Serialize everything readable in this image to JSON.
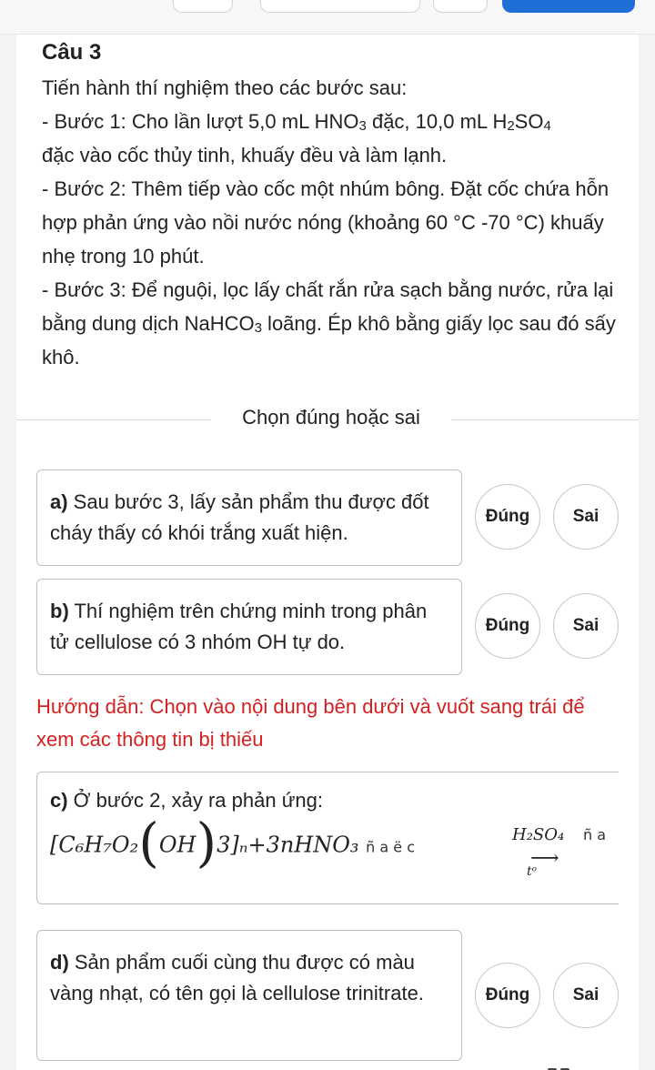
{
  "question": {
    "title": "Câu 3",
    "intro": "Tiến hành thí nghiệm theo các bước sau:",
    "step1_a": "- Bước 1: Cho lần lượt 5,0 mL HNO",
    "step1_sub1": "3",
    "step1_b": " đặc, 10,0 mL H",
    "step1_sub2": "2",
    "step1_c": "SO",
    "step1_sub3": "4",
    "step1_d": "đặc vào cốc thủy tinh, khuấy đều và làm lạnh.",
    "step2": "- Bước 2: Thêm tiếp vào cốc một nhúm bông. Đặt cốc chứa hỗn hợp phản ứng vào nồi nước nóng (khoảng 60 °C -70 °C) khuấy nhẹ trong 10 phút.",
    "step3_a": "- Bước 3: Để nguội, lọc lấy chất rắn rửa sạch bằng nước, rửa lại bằng dung dịch NaHCO",
    "step3_sub": "3",
    "step3_b": " loãng. Ép khô bằng giấy lọc sau đó sấy khô."
  },
  "section_title": "Chọn đúng hoặc sai",
  "statements": [
    {
      "label": "a)",
      "text": " Sau bước 3, lấy sản phẩm thu được đốt cháy thấy có khói trắng xuất hiện."
    },
    {
      "label": "b)",
      "text": " Thí nghiệm trên chứng minh trong phân tử cellulose có 3 nhóm OH tự do."
    },
    {
      "label": "c)",
      "text": " Ở bước 2, xảy ra phản ứng:"
    },
    {
      "label": "d)",
      "text": " Sản phẩm cuối cùng thu được có màu vàng nhạt, có tên gọi là cellulose trinitrate."
    }
  ],
  "buttons": {
    "true_label": "Đúng",
    "false_label": "Sai"
  },
  "hint": "Hướng dẫn: Chọn vào nội dung bên dưới và vuốt sang trái để xem các thông tin bị thiếu",
  "formula": {
    "left": "[C₆H₇O₂",
    "open": "(",
    "oh": "OH",
    "close": ")",
    "rest": "3]ₙ+3nHNO₃",
    "junk1": "ñ a ë c",
    "arrow_top": "H₂SO₄",
    "arrow": "⟶",
    "arrow_bottom": "tᵒ",
    "junk2": "ñ a"
  },
  "icons": {
    "grid": "grid-icon"
  }
}
